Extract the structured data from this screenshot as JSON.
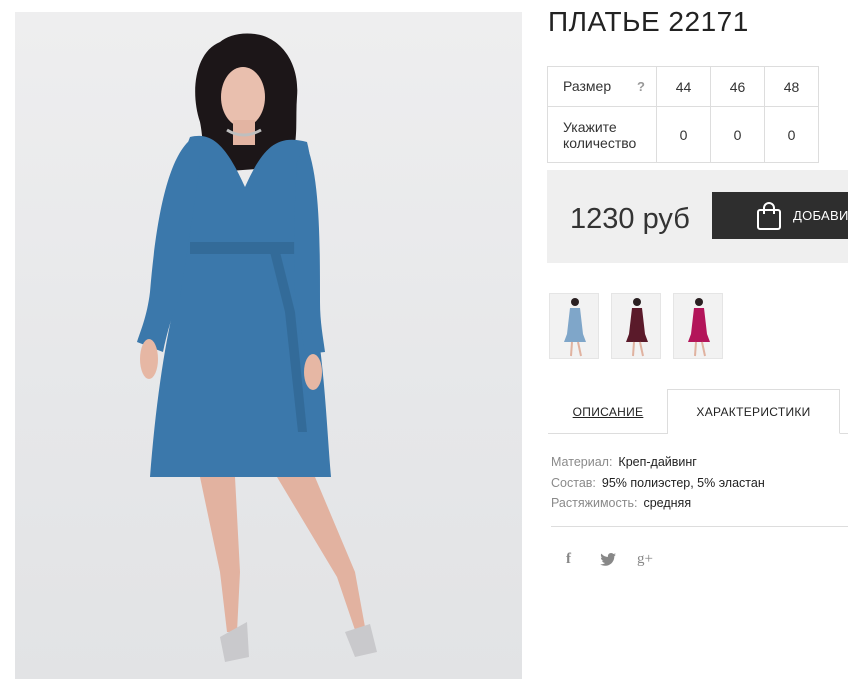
{
  "product": {
    "title": "ПЛАТЬЕ 22171"
  },
  "sizes": {
    "size_label": "Размер",
    "help_label": "?",
    "size_values": [
      "44",
      "46",
      "48"
    ],
    "qty_label_line1": "Укажите",
    "qty_label_line2": "количество",
    "qty_values": [
      "0",
      "0",
      "0"
    ]
  },
  "price": {
    "amount": "1230 руб",
    "cart_button_label": "ДОБАВИТЬ"
  },
  "colors": {
    "thumbnails": [
      "blue",
      "burgundy",
      "magenta"
    ],
    "swatch_hex": [
      "#7fa6c9",
      "#5a1a2a",
      "#b3155a"
    ]
  },
  "tabs": {
    "description": "ОПИСАНИЕ",
    "characteristics": "ХАРАКТЕРИСТИКИ"
  },
  "characteristics": [
    {
      "key": "Материал:",
      "value": "Креп-дайвинг"
    },
    {
      "key": "Состав:",
      "value": "95% полиэстер, 5% эластан"
    },
    {
      "key": "Растяжимость:",
      "value": "средняя"
    }
  ],
  "social": {
    "facebook": "f",
    "twitter": "twitter-icon",
    "googleplus": "g+"
  },
  "theme": {
    "dress_color": "#3b78ab",
    "button_bg": "#2e2e2e",
    "price_bg": "#efefef"
  }
}
